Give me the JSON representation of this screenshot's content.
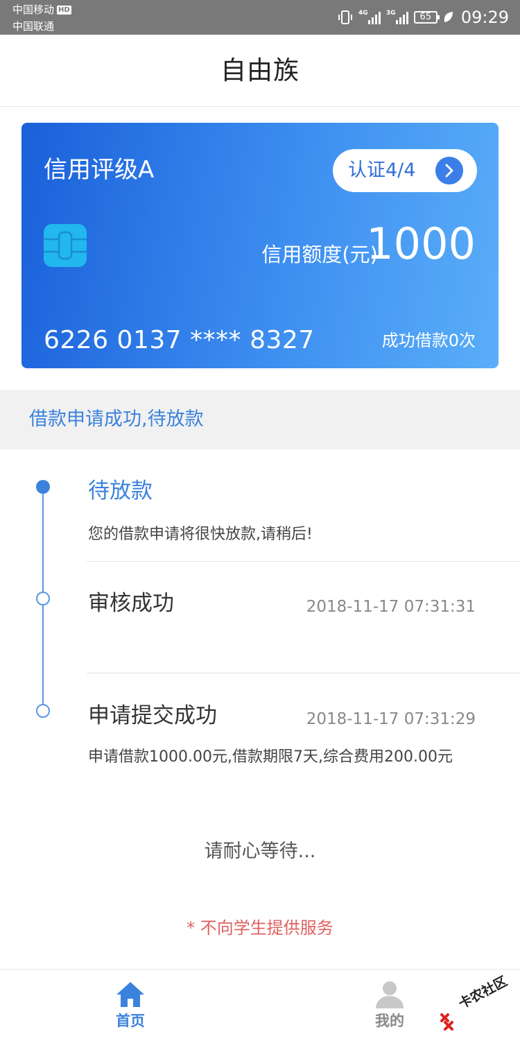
{
  "status_bar": {
    "carrier_1": "中国移动",
    "carrier_1_badge": "HD",
    "carrier_2": "中国联通",
    "network_1": "4G",
    "network_2": "3G",
    "battery": "65",
    "time": "09:29"
  },
  "header": {
    "title": "自由族"
  },
  "card": {
    "rating": "信用评级A",
    "cert_label": "认证4/4",
    "limit_label": "信用额度(元)",
    "limit_value": "1000",
    "card_number": "6226 0137 **** 8327",
    "success_count": "成功借款0次"
  },
  "notice": {
    "text": "借款申请成功,待放款"
  },
  "timeline": {
    "steps": [
      {
        "title": "待放款",
        "description": "您的借款申请将很快放款,请稍后!",
        "time": ""
      },
      {
        "title": "审核成功",
        "description": "",
        "time": "2018-11-17 07:31:31"
      },
      {
        "title": "申请提交成功",
        "description": "申请借款1000.00元,借款期限7天,综合费用200.00元",
        "time": "2018-11-17 07:31:29"
      }
    ]
  },
  "wait_text": "请耐心等待...",
  "student_notice": "* 不向学生提供服务",
  "tabbar": {
    "home_label": "首页",
    "mine_label": "我的"
  },
  "watermark": {
    "text": "卡农社区"
  },
  "colors": {
    "accent": "#3b82dc",
    "card_gradient_start": "#1a60da",
    "card_gradient_end": "#5aaef8",
    "warning": "#e06060"
  },
  "icons": {
    "home": "home-icon",
    "user": "user-icon",
    "chip": "card-chip-icon",
    "arrow": "chevron-right-icon"
  }
}
